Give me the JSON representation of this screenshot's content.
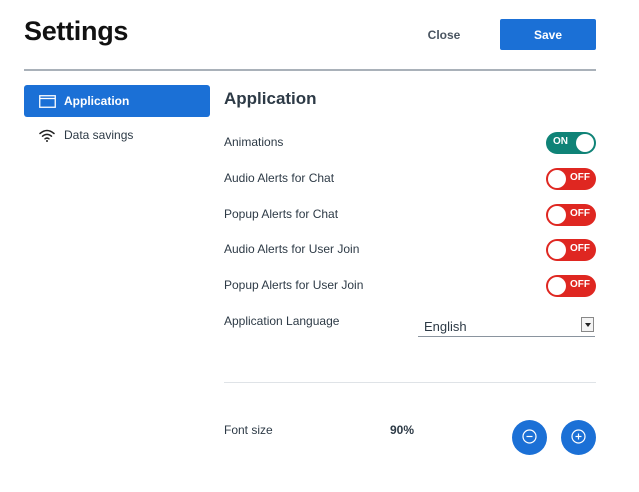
{
  "header": {
    "title": "Settings",
    "close_label": "Close",
    "save_label": "Save"
  },
  "sidebar": {
    "items": [
      {
        "label": "Application",
        "icon": "window-icon",
        "active": true
      },
      {
        "label": "Data savings",
        "icon": "wifi-icon",
        "active": false
      }
    ]
  },
  "main": {
    "section_title": "Application",
    "toggles": [
      {
        "label": "Animations",
        "state": "ON"
      },
      {
        "label": "Audio Alerts for Chat",
        "state": "OFF"
      },
      {
        "label": "Popup Alerts for Chat",
        "state": "OFF"
      },
      {
        "label": "Audio Alerts for User Join",
        "state": "OFF"
      },
      {
        "label": "Popup Alerts for User Join",
        "state": "OFF"
      }
    ],
    "language": {
      "label": "Application Language",
      "selected": "English"
    },
    "font_size": {
      "label": "Font size",
      "value": "90%"
    }
  },
  "colors": {
    "accent": "#1b70d6",
    "toggle_on": "#0f8377",
    "toggle_off": "#df2721"
  }
}
